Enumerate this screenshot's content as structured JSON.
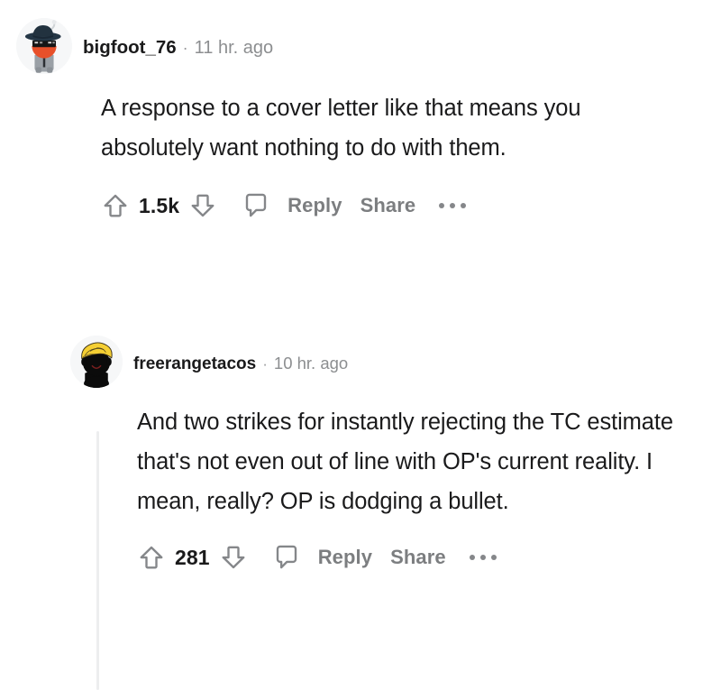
{
  "theme": {
    "page_background": "#ffffff",
    "text_primary": "#1a1a1b",
    "text_muted": "#8c8e90",
    "action_gray": "#7c7e80",
    "icon_gray": "#85878a",
    "thread_line": "#edeeef",
    "avatar_background": "#f6f7f8"
  },
  "comments": [
    {
      "id": "comment-1",
      "depth": 0,
      "author": "bigfoot_76",
      "separator": "·",
      "timestamp": "11 hr. ago",
      "avatar": {
        "name": "avatar-bigfoot-76",
        "description": "snoo-with-fedora-and-sunglasses",
        "colors": {
          "hat": "#253746",
          "face": "#f7f5f2",
          "scarf": "#e8502a",
          "glasses": "#161616",
          "body": "#9aa0a6",
          "tie": "#2b2f33"
        }
      },
      "body": "A response to a cover letter like that means you absolutely want nothing to do with them.",
      "actions": {
        "upvote_icon": "upvote-arrow-icon",
        "score": "1.5k",
        "downvote_icon": "downvote-arrow-icon",
        "comment_icon": "speech-bubble-icon",
        "reply_label": "Reply",
        "share_label": "Share",
        "overflow_icon": "ellipsis-icon"
      }
    },
    {
      "id": "comment-2",
      "depth": 1,
      "author": "freerangetacos",
      "separator": "·",
      "timestamp": "10 hr. ago",
      "avatar": {
        "name": "avatar-freerangetacos",
        "description": "black-silhouette-with-blonde-hair",
        "colors": {
          "hair": "#f5cf33",
          "hair_outline": "#3a3018",
          "silhouette": "#0b0b0b",
          "smile": "#7a1f1f"
        }
      },
      "body": "And two strikes for instantly rejecting the TC estimate that's not even out of line with OP's current reality. I mean, really? OP is dodging a bullet.",
      "actions": {
        "upvote_icon": "upvote-arrow-icon",
        "score": "281",
        "downvote_icon": "downvote-arrow-icon",
        "comment_icon": "speech-bubble-icon",
        "reply_label": "Reply",
        "share_label": "Share",
        "overflow_icon": "ellipsis-icon"
      }
    }
  ]
}
